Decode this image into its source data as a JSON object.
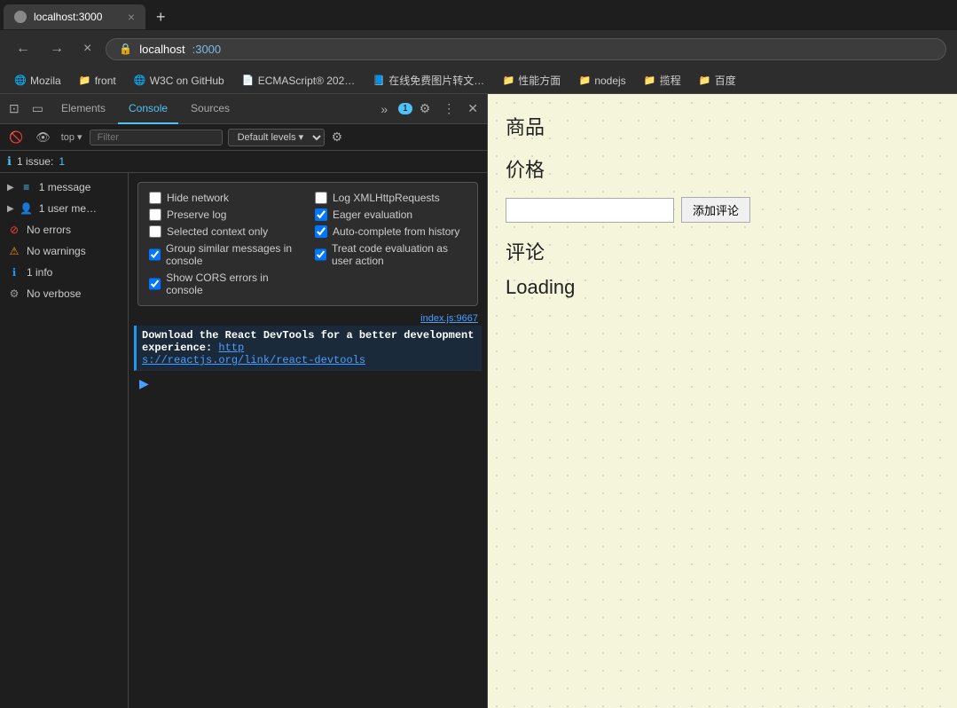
{
  "browser": {
    "tab_title": "localhost:3000",
    "new_tab_label": "+",
    "close_tab": "×",
    "nav_back": "←",
    "nav_forward": "→",
    "nav_close": "×",
    "address_protocol": "localhost",
    "address_port": ":3000",
    "address_icon": "🔒"
  },
  "bookmarks": [
    {
      "id": "mozila",
      "icon": "🌐",
      "label": "Mozila"
    },
    {
      "id": "front",
      "icon": "📁",
      "label": "front"
    },
    {
      "id": "w3c",
      "icon": "🌐",
      "label": "W3C on GitHub"
    },
    {
      "id": "ecma",
      "icon": "📄",
      "label": "ECMAScript® 202…"
    },
    {
      "id": "zaixian",
      "icon": "📘",
      "label": "在线免费图片转文…"
    },
    {
      "id": "perf",
      "icon": "📁",
      "label": "性能方面"
    },
    {
      "id": "nodejs",
      "icon": "📁",
      "label": "nodejs"
    },
    {
      "id": "tanc",
      "icon": "📁",
      "label": "揽程"
    },
    {
      "id": "baidu",
      "icon": "📁",
      "label": "百度"
    }
  ],
  "devtools": {
    "tabs": [
      {
        "id": "elements",
        "label": "Elements",
        "active": false
      },
      {
        "id": "console",
        "label": "Console",
        "active": true
      },
      {
        "id": "sources",
        "label": "Sources",
        "active": false
      }
    ],
    "more_label": "»",
    "badge_count": "1",
    "console_filter_placeholder": "Filter",
    "console_level": "Default levels ▾",
    "issues_label": "1 issue:",
    "issues_icon": "ℹ",
    "issues_count": "1",
    "sidebar": [
      {
        "id": "messages",
        "icon": "msg",
        "label": "1 message",
        "has_expand": true,
        "has_icon2": true
      },
      {
        "id": "user-messages",
        "icon": "user",
        "label": "1 user me…",
        "has_expand": true
      },
      {
        "id": "errors",
        "icon": "error",
        "label": "No errors",
        "has_expand": false
      },
      {
        "id": "warnings",
        "icon": "warning",
        "label": "No warnings",
        "has_expand": false
      },
      {
        "id": "info",
        "icon": "info",
        "label": "1 info",
        "has_expand": false
      },
      {
        "id": "verbose",
        "icon": "verbose",
        "label": "No verbose",
        "has_expand": false
      }
    ],
    "settings": {
      "left_options": [
        {
          "id": "hide-network",
          "label": "Hide network",
          "checked": false
        },
        {
          "id": "preserve-log",
          "label": "Preserve log",
          "checked": false
        },
        {
          "id": "selected-context",
          "label": "Selected context only",
          "checked": false
        },
        {
          "id": "group-similar",
          "label": "Group similar messages in console",
          "checked": true
        },
        {
          "id": "show-cors",
          "label": "Show CORS errors in console",
          "checked": true
        }
      ],
      "right_options": [
        {
          "id": "log-xmlhttp",
          "label": "Log XMLHttpRequests",
          "checked": false
        },
        {
          "id": "eager-eval",
          "label": "Eager evaluation",
          "checked": true
        },
        {
          "id": "autocomplete",
          "label": "Auto-complete from history",
          "checked": true
        },
        {
          "id": "treat-code",
          "label": "Treat code evaluation as user action",
          "checked": true
        }
      ]
    },
    "console_message": {
      "text_part1": "Download the React DevTools for a better development experience: ",
      "link_text": "http://s://reactjs.org/link/react-devtools",
      "link_url": "https://reactjs.org/link/react-devtools",
      "source": "index.js:9667"
    }
  },
  "webpage": {
    "product_label": "商品",
    "price_label": "价格",
    "comment_placeholder": "",
    "add_comment_btn": "添加评论",
    "reviews_label": "评论",
    "loading_label": "Loading"
  }
}
